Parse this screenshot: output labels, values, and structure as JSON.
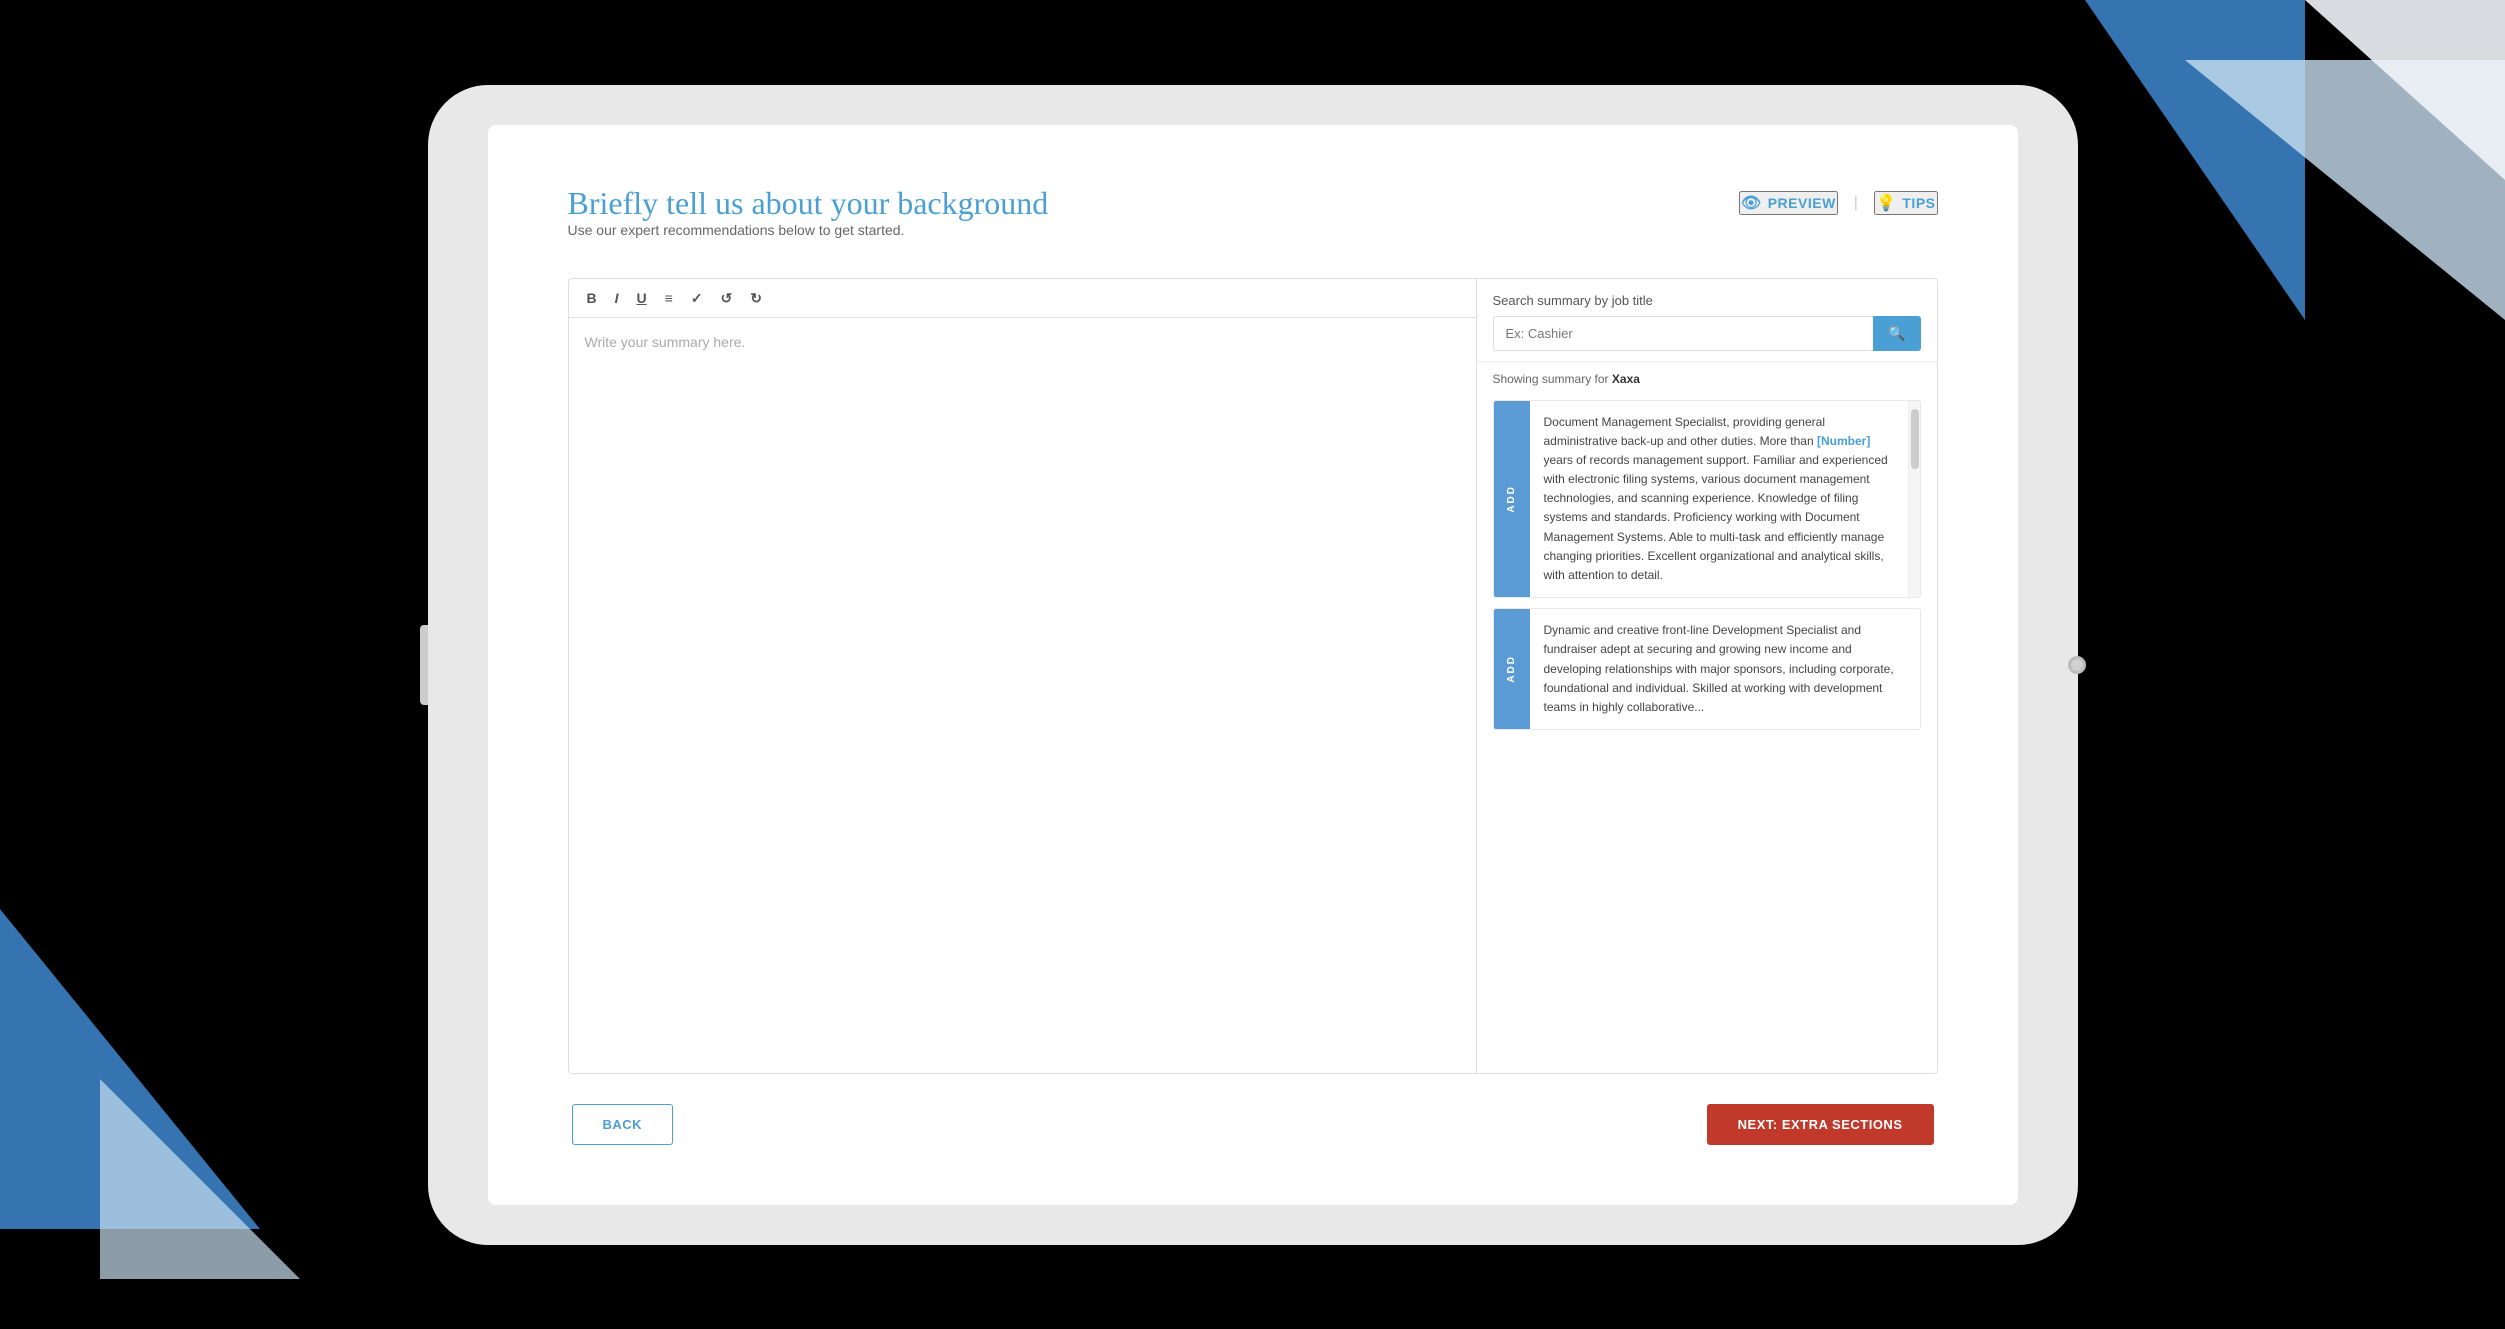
{
  "page": {
    "title": "Briefly tell us about your background",
    "subtitle": "Use our expert recommendations below to get started.",
    "preview_label": "PREVIEW",
    "tips_label": "TIPS"
  },
  "toolbar": {
    "bold": "B",
    "italic": "I",
    "underline": "U",
    "list": "≡",
    "check": "✓",
    "undo": "↺",
    "redo": "↻"
  },
  "editor": {
    "placeholder": "Write your summary here."
  },
  "suggestions": {
    "header": "Search summary by job title",
    "search_placeholder": "Ex: Cashier",
    "showing_label": "Showing summary for",
    "showing_name": "Xaxa",
    "items": [
      {
        "add_label": "ADD",
        "text_parts": [
          {
            "text": "Document Management Specialist, providing general administrative back-up and other duties. More than "
          },
          {
            "text": "[Number]",
            "highlight": true
          },
          {
            "text": " years of records management support. Familiar and experienced with electronic filing systems, various document management technologies, and scanning experience. Knowledge of filing systems and standards. Proficiency working with Document Management Systems. Able to multi-task and efficiently manage changing priorities. Excellent organizational and analytical skills, with attention to detail."
          }
        ]
      },
      {
        "add_label": "ADD",
        "text_parts": [
          {
            "text": "Dynamic and creative front-line Development Specialist and fundraiser adept at securing and growing new income and developing relationships with major sponsors, including corporate, foundational and individual. Skilled at working with development teams in highly collaborative..."
          }
        ]
      }
    ]
  },
  "navigation": {
    "back_label": "BACK",
    "next_label": "NEXT: EXTRA SECTIONS"
  }
}
